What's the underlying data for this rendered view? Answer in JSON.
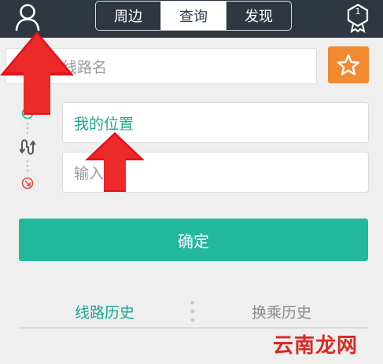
{
  "header": {
    "tabs": [
      {
        "label": "周边",
        "active": false
      },
      {
        "label": "查询",
        "active": true
      },
      {
        "label": "发现",
        "active": false
      }
    ],
    "badge_number": "1"
  },
  "line_search": {
    "placeholder": "入线路名"
  },
  "route": {
    "from_value": "我的位置",
    "to_placeholder": "输入 点"
  },
  "confirm_label": "确定",
  "history_tabs": {
    "line_history": "线路历史",
    "transfer_history": "换乘历史"
  },
  "watermark": "云南龙网",
  "colors": {
    "top_bar": "#2f3742",
    "accent_green": "#22b89b",
    "star_orange": "#f28a32",
    "arrow_red": "#e3121b"
  },
  "icons": [
    "user-icon",
    "medal-icon",
    "star-icon",
    "origin-icon",
    "swap-icon",
    "destination-icon"
  ]
}
